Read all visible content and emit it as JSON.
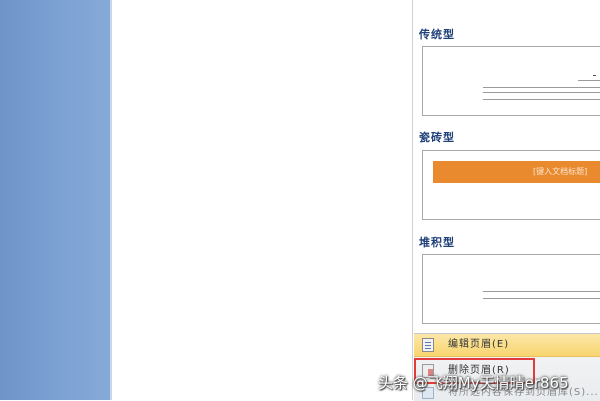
{
  "gallery": {
    "sections": [
      {
        "title": "传统型"
      },
      {
        "title": "瓷砖型",
        "placeholder_text": "[键入文档标题]"
      },
      {
        "title": "堆积型"
      }
    ]
  },
  "menu": {
    "edit_label": "编辑页眉(E)",
    "delete_label": "删除页眉(R)",
    "save_label": "将所选内容保存到页眉库(S)..."
  },
  "watermark": {
    "text": "头条 @飞翔My天情晴er865"
  },
  "colors": {
    "accent_orange": "#ea8a2e",
    "highlight_red": "#e23b3b",
    "section_title": "#1f3f78",
    "left_panel": "#7aa0d2"
  }
}
